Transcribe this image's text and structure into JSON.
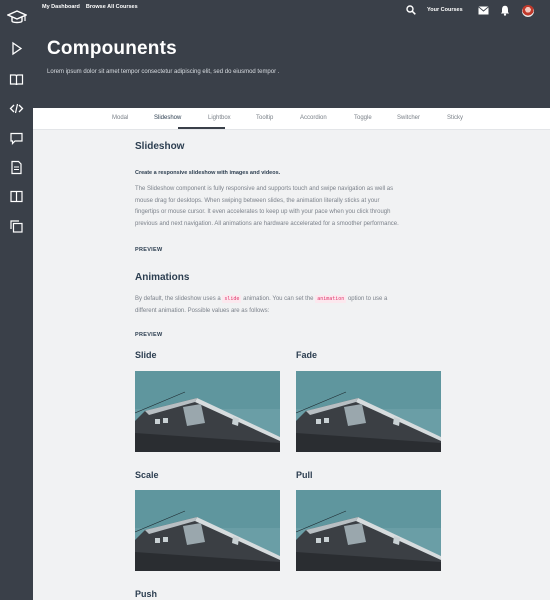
{
  "nav": {
    "dashboard": "My Dashboard",
    "browse": "Browse All Courses",
    "your_courses": "Your Courses"
  },
  "header": {
    "title": "Compounents",
    "subtitle": "Lorem ipsum dolor sit amet tempor consectetur adipiscing elit, sed do eiusmod tempor ."
  },
  "tabs": [
    "Modal",
    "Slideshow",
    "Lightbox",
    "Tooltip",
    "Accordion",
    "Toggle",
    "Switcher",
    "Sticky"
  ],
  "slideshow": {
    "title": "Slideshow",
    "lead": "Create a responsive slideshow with images and videos.",
    "para1": "The Slideshow component is fully responsive and supports touch and swipe navigation as well as",
    "para2": "mouse drag for desktops. When swiping between slides, the animation literally sticks at your",
    "para3": "fingertips or mouse cursor. It even accelerates to keep up with your pace when you click through",
    "para4": "previous and next navigation. All animations are hardware accelerated for a smoother performance.",
    "preview": "PREVIEW"
  },
  "animations": {
    "title": "Animations",
    "text_a": "By default, the slideshow uses a ",
    "code1": "slide",
    "text_b": " animation. You can set the ",
    "code2": "animation",
    "text_c": " option to use a",
    "line2": "different animation. Possible values are as follows:",
    "preview": "PREVIEW",
    "examples": [
      "Slide",
      "Fade",
      "Scale",
      "Pull",
      "Push"
    ]
  },
  "colors": {
    "dark": "#3a4049",
    "accent_code": "#e0356b"
  },
  "icons": [
    "graduation-cap",
    "play",
    "book",
    "code",
    "comment",
    "document",
    "columns",
    "copy",
    "search",
    "envelope",
    "bell"
  ]
}
